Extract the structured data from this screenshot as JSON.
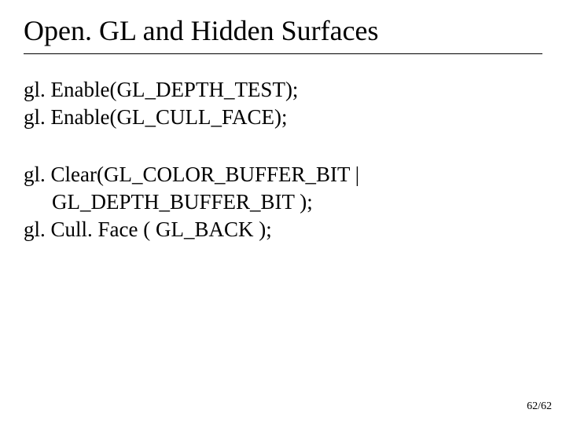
{
  "title": "Open. GL and Hidden Surfaces",
  "block1": {
    "line1": "gl. Enable(GL_DEPTH_TEST);",
    "line2": "gl. Enable(GL_CULL_FACE);"
  },
  "block2": {
    "line1": "gl. Clear(GL_COLOR_BUFFER_BIT |",
    "line2": "GL_DEPTH_BUFFER_BIT );",
    "line3": "gl. Cull. Face ( GL_BACK );"
  },
  "page_number": "62/62"
}
